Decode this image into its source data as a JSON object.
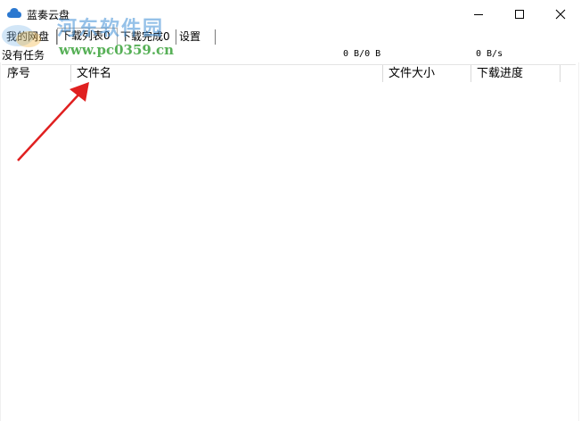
{
  "window": {
    "title": "蓝奏云盘",
    "minimize_icon": "minimize-icon",
    "maximize_icon": "maximize-icon",
    "close_icon": "close-icon"
  },
  "tabs": [
    {
      "label": "我的网盘"
    },
    {
      "label": "下载列表0",
      "active": true
    },
    {
      "label": "下载完成0"
    },
    {
      "label": "设置"
    }
  ],
  "status": {
    "task_text": "没有任务",
    "progress_text": "0 B/0 B",
    "speed_text": "0 B/s"
  },
  "table": {
    "columns": [
      "序号",
      "文件名",
      "文件大小",
      "下载进度"
    ],
    "rows": []
  },
  "watermark": {
    "text": "河东软件园",
    "url": "www.pc0359.cn"
  },
  "colors": {
    "arrow": "#e02020",
    "watermark_text": "#3f8fd6",
    "watermark_url": "#3aa33a"
  }
}
